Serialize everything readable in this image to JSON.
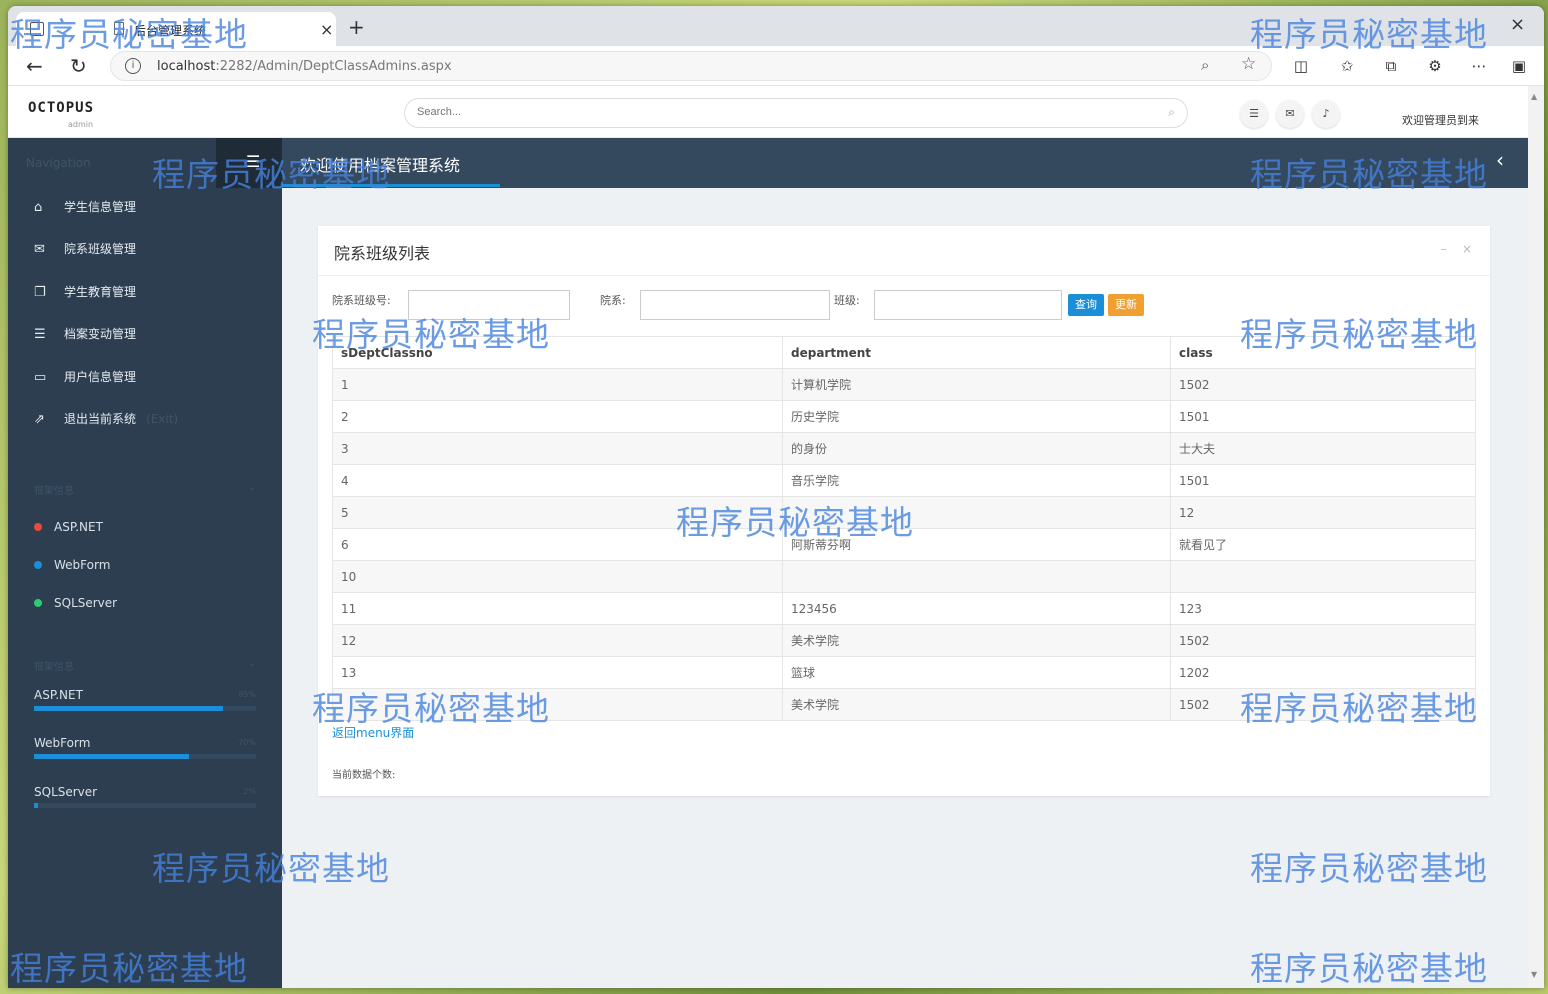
{
  "browser": {
    "tab_title": "后台管理系统",
    "tab_close": "×",
    "new_tab": "+",
    "window_close": "×",
    "url_host": "localhost",
    "url_rest": ":2282/Admin/DeptClassAdmins.aspx"
  },
  "header": {
    "logo": "OCTOPUS",
    "logo_sub": "admin",
    "search_placeholder": "Search...",
    "welcome": "欢迎管理员到来"
  },
  "sidebar": {
    "nav_title": "Navigation",
    "items": [
      {
        "label": "学生信息管理",
        "icon": "home-icon"
      },
      {
        "label": "院系班级管理",
        "icon": "envelope-icon"
      },
      {
        "label": "学生教育管理",
        "icon": "copy-icon"
      },
      {
        "label": "档案变动管理",
        "icon": "list-icon"
      },
      {
        "label": "用户信息管理",
        "icon": "card-icon"
      },
      {
        "label": "退出当前系统",
        "extra": "(Exit)",
        "icon": "external-link-icon"
      }
    ],
    "section1_title": "框架信息",
    "tags": [
      {
        "label": "ASP.NET",
        "color": "#e74c3c"
      },
      {
        "label": "WebForm",
        "color": "#1a8fd8"
      },
      {
        "label": "SQLServer",
        "color": "#2ecc71"
      }
    ],
    "section2_title": "框架信息",
    "progress": [
      {
        "label": "ASP.NET",
        "pct_label": "85%",
        "value": 85
      },
      {
        "label": "WebForm",
        "pct_label": "70%",
        "value": 70
      },
      {
        "label": "SQLServer",
        "pct_label": "2%",
        "value": 2
      }
    ]
  },
  "topbar": {
    "title": "欢迎使用档案管理系统"
  },
  "panel": {
    "title": "院系班级列表",
    "filter_no_label": "院系班级号:",
    "filter_dept_label": "院系:",
    "filter_class_label": "班级:",
    "query_button": "查询",
    "refresh_button": "更新",
    "columns": [
      "sDeptClassno",
      "department",
      "class"
    ],
    "rows": [
      [
        "1",
        "计算机学院",
        "1502"
      ],
      [
        "2",
        "历史学院",
        "1501"
      ],
      [
        "3",
        "的身份",
        "士大夫"
      ],
      [
        "4",
        "音乐学院",
        "1501"
      ],
      [
        "5",
        "",
        "12"
      ],
      [
        "6",
        "阿斯蒂芬啊",
        "就看见了"
      ],
      [
        "10",
        "",
        ""
      ],
      [
        "11",
        "123456",
        "123"
      ],
      [
        "12",
        "美术学院",
        "1502"
      ],
      [
        "13",
        "篮球",
        "1202"
      ],
      [
        "",
        "美术学院",
        "1502"
      ]
    ],
    "back_link": "返回menu界面",
    "count_label": "当前数据个数:"
  },
  "watermark": "程序员秘密基地"
}
